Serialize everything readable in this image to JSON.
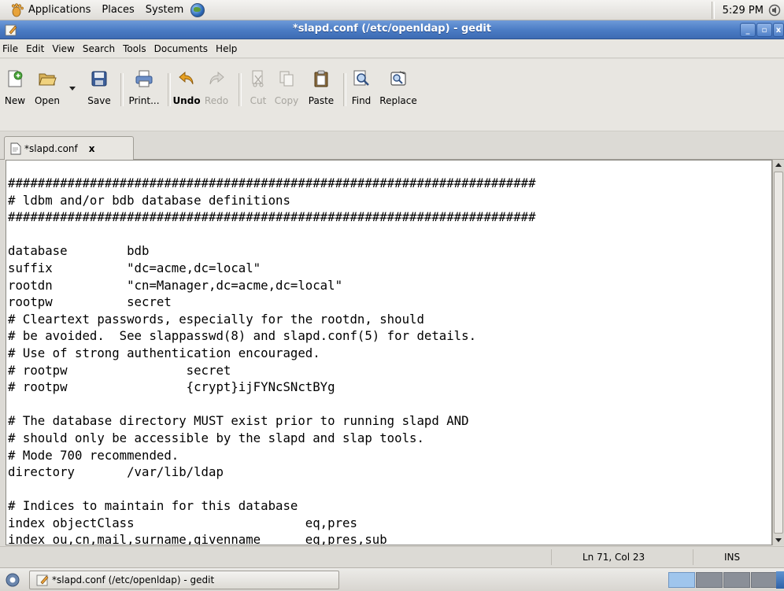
{
  "top_panel": {
    "menus": [
      "Applications",
      "Places",
      "System"
    ],
    "clock": "5:29 PM"
  },
  "window": {
    "title": "*slapd.conf (/etc/openldap) - gedit"
  },
  "menubar": {
    "items": [
      "File",
      "Edit",
      "View",
      "Search",
      "Tools",
      "Documents",
      "Help"
    ]
  },
  "toolbar": {
    "new": "New",
    "open": "Open",
    "save": "Save",
    "print": "Print...",
    "undo": "Undo",
    "redo": "Redo",
    "cut": "Cut",
    "copy": "Copy",
    "paste": "Paste",
    "find": "Find",
    "replace": "Replace"
  },
  "tab": {
    "label": "*slapd.conf",
    "close": "x"
  },
  "editor": {
    "lines": [
      "#######################################################################",
      "# ldbm and/or bdb database definitions",
      "#######################################################################",
      "",
      "database        bdb",
      "suffix          \"dc=acme,dc=local\"",
      "rootdn          \"cn=Manager,dc=acme,dc=local\"",
      "rootpw          secret",
      "# Cleartext passwords, especially for the rootdn, should",
      "# be avoided.  See slappasswd(8) and slapd.conf(5) for details.",
      "# Use of strong authentication encouraged.",
      "# rootpw                secret",
      "# rootpw                {crypt}ijFYNcSNctBYg",
      "",
      "# The database directory MUST exist prior to running slapd AND",
      "# should only be accessible by the slapd and slap tools.",
      "# Mode 700 recommended.",
      "directory       /var/lib/ldap",
      "",
      "# Indices to maintain for this database",
      "index objectClass                       eq,pres",
      "index ou,cn,mail,surname,givenname      eq,pres,sub"
    ]
  },
  "statusbar": {
    "cursor": "Ln 71, Col 23",
    "mode": "INS"
  },
  "taskbar": {
    "task_label": "*slapd.conf (/etc/openldap) - gedit"
  }
}
